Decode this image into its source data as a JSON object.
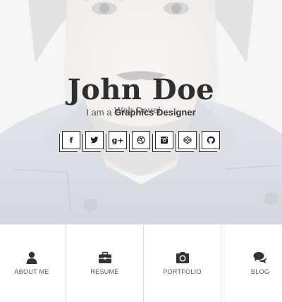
{
  "profile": {
    "name": "John Doe",
    "role_prefix": "I am a",
    "role_typed": "Graphics Designer",
    "role_ghost": "Web Devel"
  },
  "socials": [
    {
      "icon": "facebook-icon",
      "glyph": "f"
    },
    {
      "icon": "twitter-icon",
      "glyph": ""
    },
    {
      "icon": "google-plus-icon",
      "glyph": "g+"
    },
    {
      "icon": "dribbble-icon",
      "glyph": ""
    },
    {
      "icon": "instagram-icon",
      "glyph": ""
    },
    {
      "icon": "codepen-icon",
      "glyph": ""
    },
    {
      "icon": "github-icon",
      "glyph": ""
    }
  ],
  "nav": [
    {
      "label": "About Me",
      "icon": "user-icon"
    },
    {
      "label": "Resume",
      "icon": "briefcase-icon"
    },
    {
      "label": "Portfolio",
      "icon": "camera-icon"
    },
    {
      "label": "Blog",
      "icon": "comments-icon"
    }
  ],
  "colors": {
    "text_dark": "#2f2f2f",
    "icon_dark": "#333333",
    "divider": "#e2e2e2",
    "hero_bg": "#f1f1f1"
  }
}
